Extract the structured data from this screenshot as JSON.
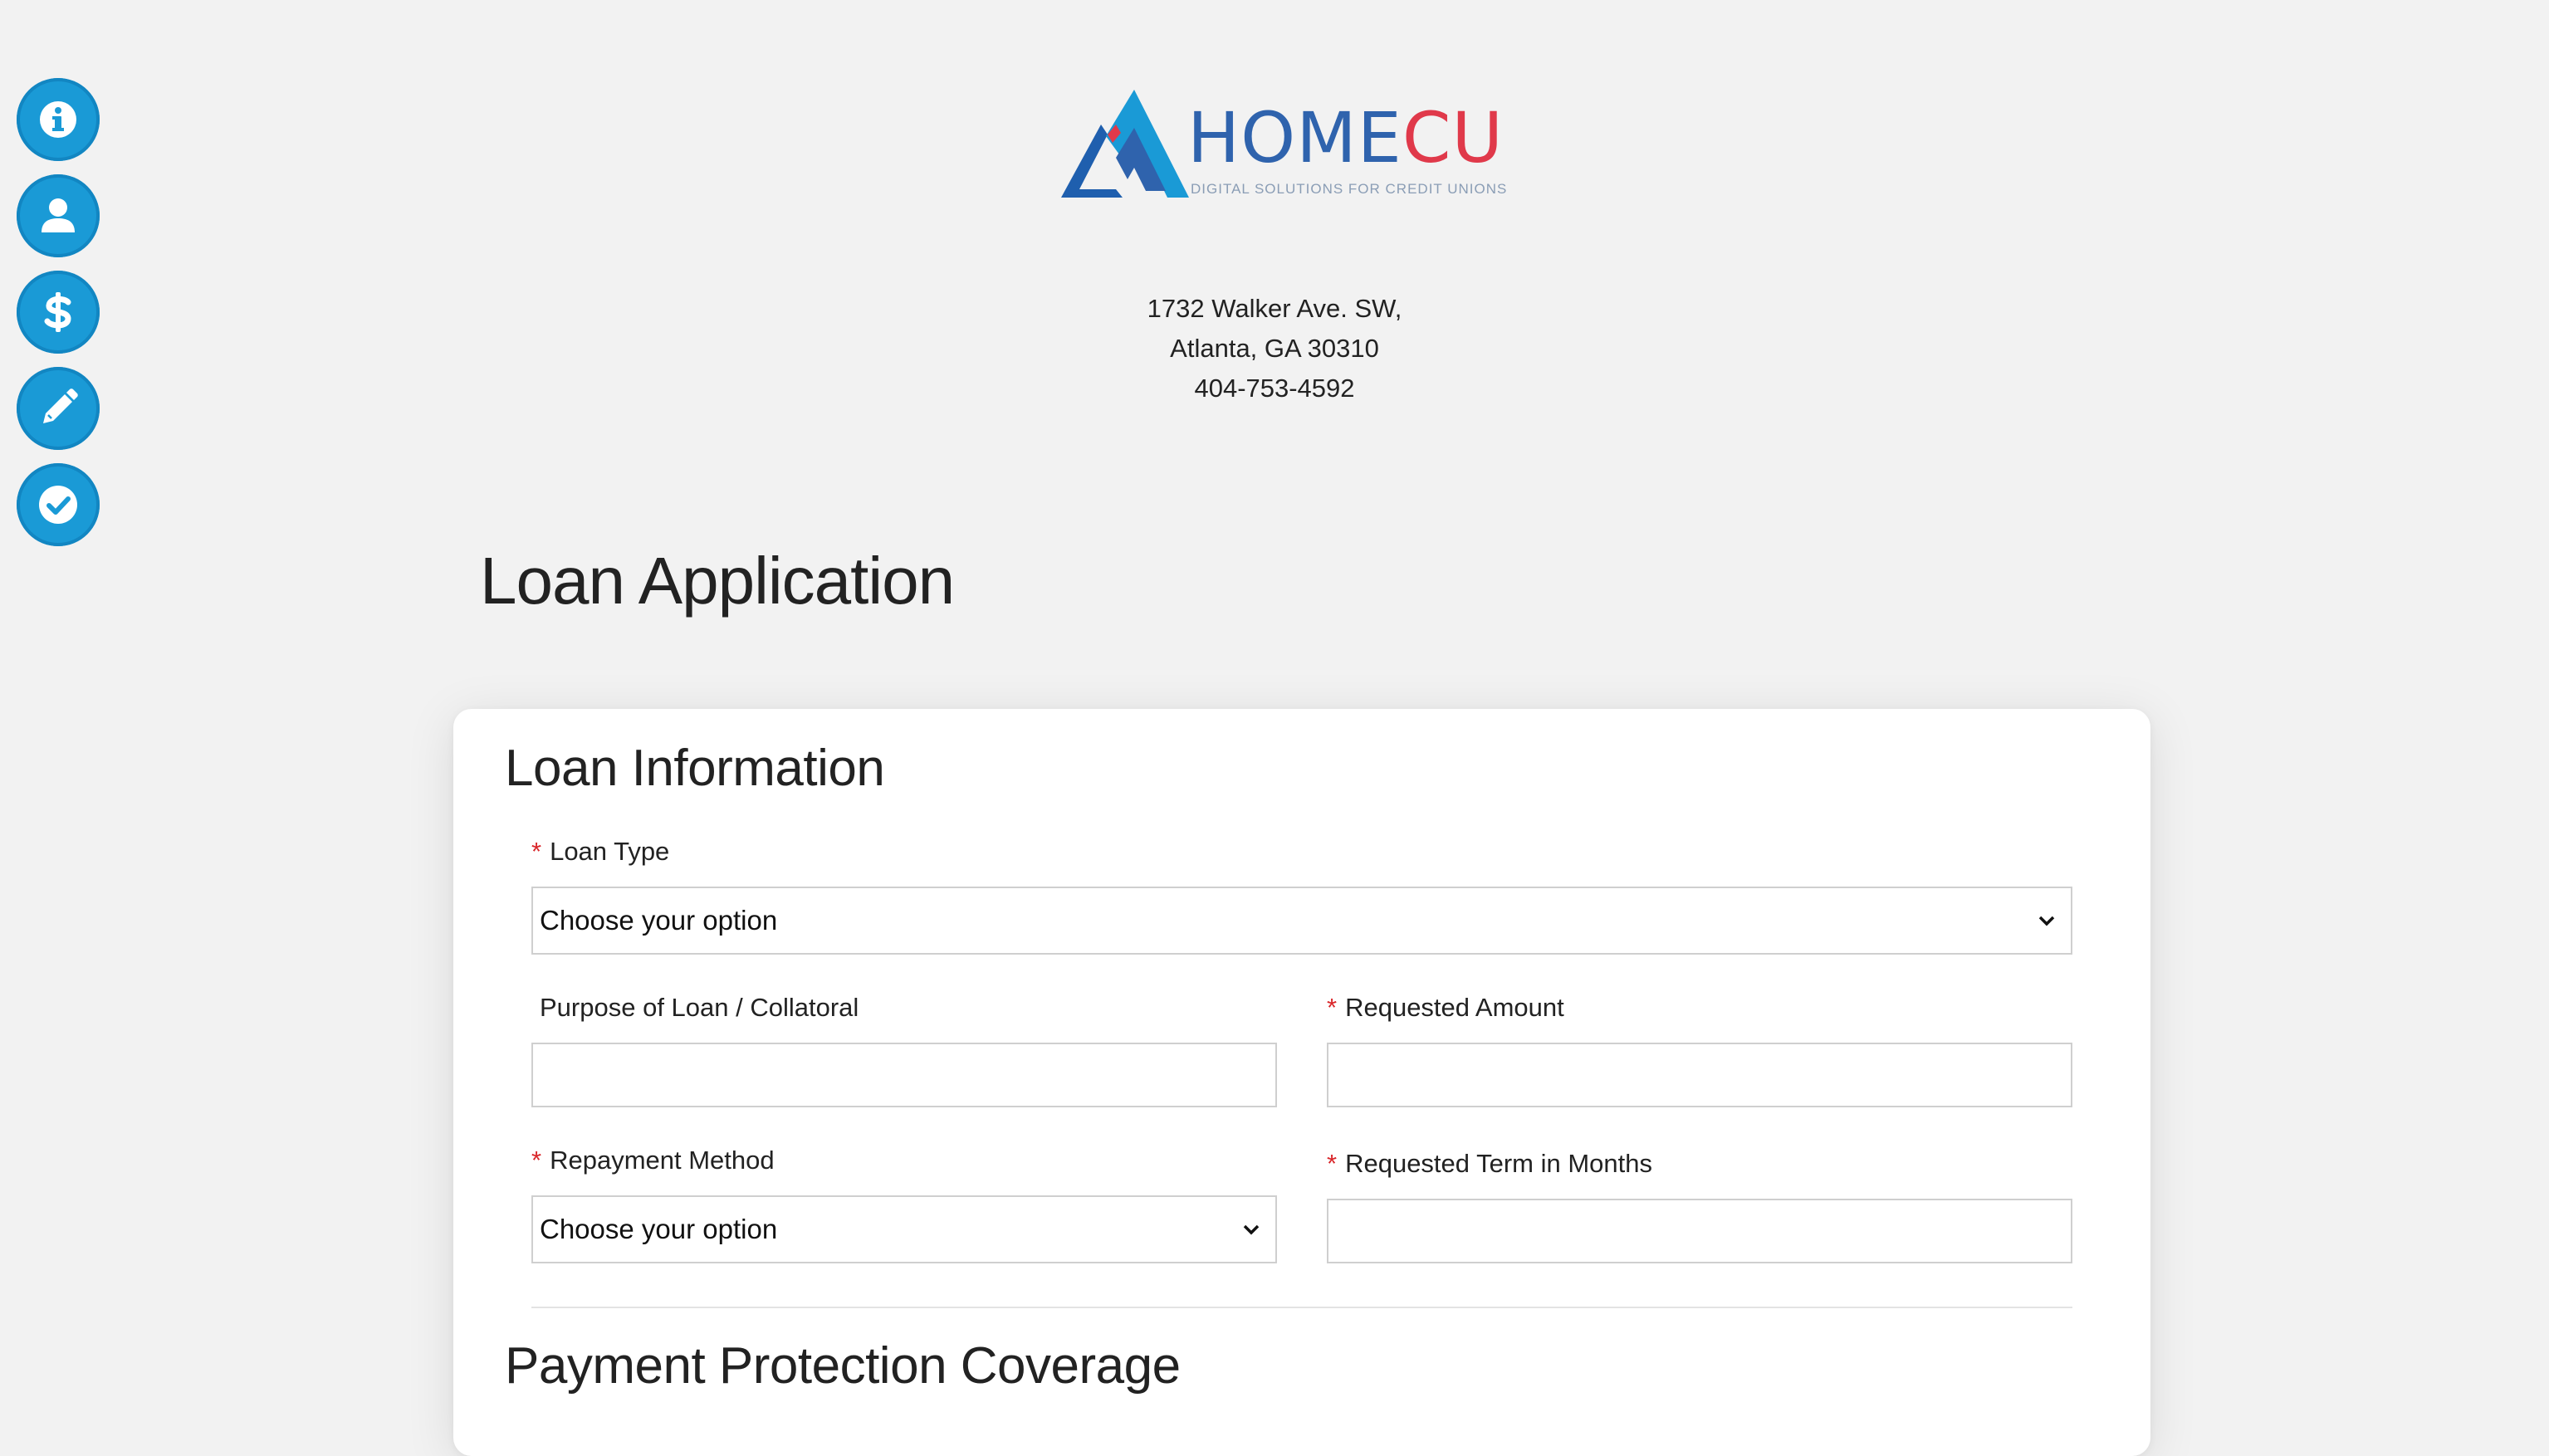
{
  "steps": [
    {
      "name": "info-icon",
      "label": "Information"
    },
    {
      "name": "user-icon",
      "label": "Applicant"
    },
    {
      "name": "dollar-icon",
      "label": "Loan"
    },
    {
      "name": "pencil-icon",
      "label": "Sign"
    },
    {
      "name": "check-icon",
      "label": "Review"
    }
  ],
  "logo": {
    "wordmark_home": "HOME",
    "wordmark_cu": "CU",
    "tagline": "DIGITAL SOLUTIONS FOR CREDIT UNIONS"
  },
  "address": {
    "line1": "1732 Walker Ave. SW,",
    "line2": "Atlanta, GA 30310",
    "phone": "404-753-4592"
  },
  "page_title": "Loan Application",
  "loan_info": {
    "title": "Loan Information",
    "required_mark": "*",
    "loan_type": {
      "label": "Loan Type",
      "value": "Choose your option"
    },
    "purpose": {
      "label": "Purpose of Loan / Collatoral",
      "value": ""
    },
    "requested_amount": {
      "label": "Requested Amount",
      "value": ""
    },
    "repayment_method": {
      "label": "Repayment Method",
      "value": "Choose your option"
    },
    "requested_term": {
      "label": "Requested Term in Months",
      "value": ""
    }
  },
  "payment_protection": {
    "title": "Payment Protection Coverage"
  },
  "colors": {
    "accent": "#1a9ad6",
    "brand_blue": "#2f63ad",
    "brand_red": "#e0394a",
    "required": "#d9262a"
  }
}
